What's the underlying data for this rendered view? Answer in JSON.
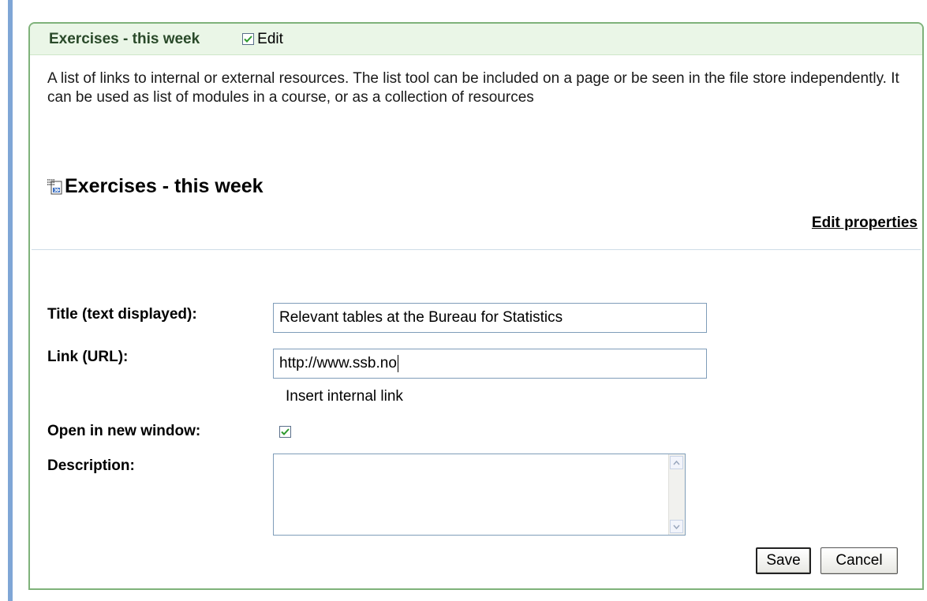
{
  "header": {
    "title": "Exercises - this week",
    "edit_label": "Edit",
    "edit_checked": true
  },
  "description": "A list of links to internal or external resources. The list tool can be included on a page or be seen in the file store independently. It can be used as list of modules in a course, or as a collection of resources",
  "list_heading": "Exercises - this week",
  "edit_properties_label": "Edit properties",
  "form": {
    "title_label": "Title (text displayed):",
    "title_value": "Relevant tables at the Bureau for Statistics",
    "link_label": "Link (URL):",
    "link_value": "http://www.ssb.no",
    "insert_internal_link": "Insert internal link",
    "open_new_window_label": "Open in new window:",
    "open_new_window_checked": true,
    "description_label": "Description:",
    "description_value": ""
  },
  "buttons": {
    "save": "Save",
    "cancel": "Cancel"
  },
  "colors": {
    "panel_border": "#7fb27a",
    "header_bg": "#eaf6e7",
    "check_green": "#2f9a2f",
    "left_bar": "#7fa6d6"
  }
}
